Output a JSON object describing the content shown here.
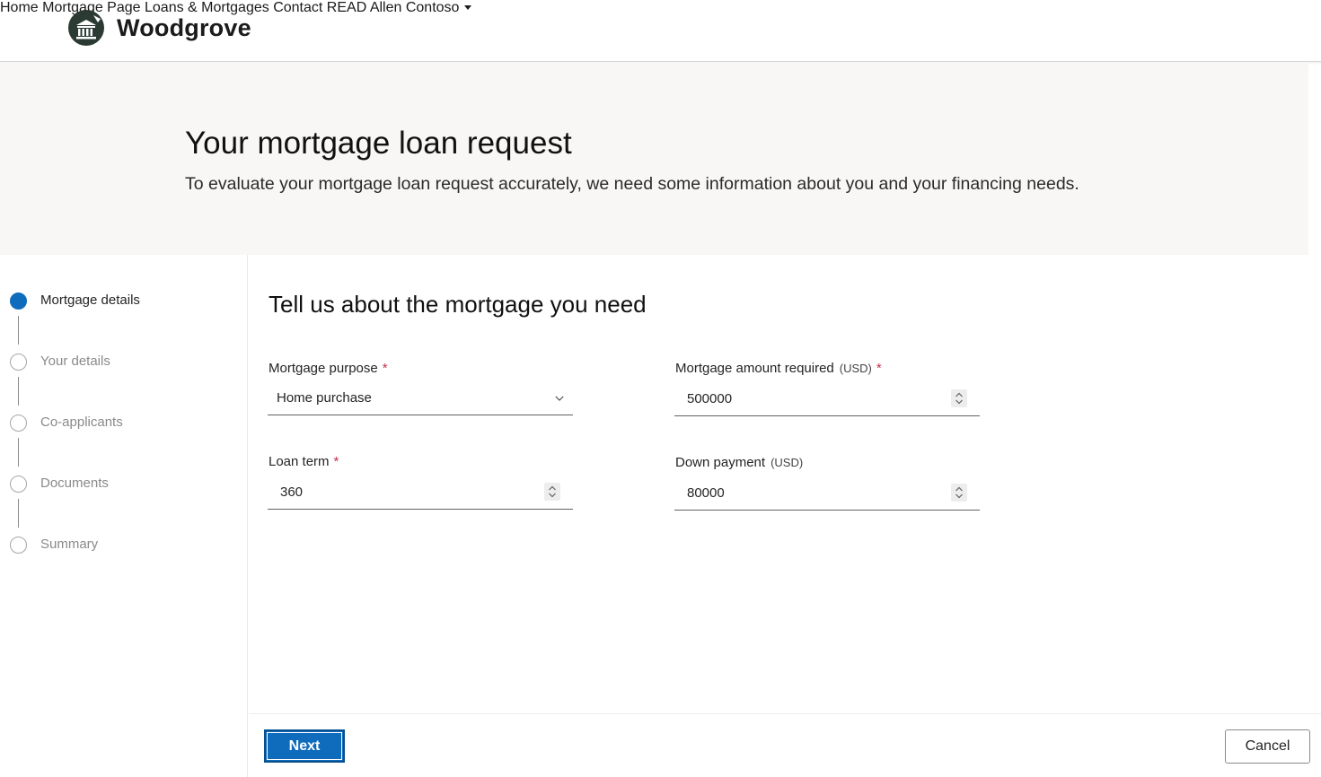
{
  "header": {
    "brand": "Woodgrove",
    "nav": [
      {
        "label": "Home"
      },
      {
        "label": "Mortgage Page"
      },
      {
        "label": "Loans & Mortgages"
      },
      {
        "label": "Contact READ"
      }
    ],
    "user": "Allen Contoso"
  },
  "hero": {
    "title": "Your mortgage loan request",
    "subtitle": "To evaluate your mortgage loan request accurately, we need some information about you and your financing needs."
  },
  "steps": [
    {
      "label": "Mortgage details",
      "active": true
    },
    {
      "label": "Your details",
      "active": false
    },
    {
      "label": "Co-applicants",
      "active": false
    },
    {
      "label": "Documents",
      "active": false
    },
    {
      "label": "Summary",
      "active": false
    }
  ],
  "form": {
    "title": "Tell us about the mortgage you need",
    "purpose": {
      "label": "Mortgage purpose",
      "required": "*",
      "value": "Home purchase"
    },
    "amount": {
      "label": "Mortgage amount required",
      "unit": "(USD)",
      "required": "*",
      "value": "500000"
    },
    "term": {
      "label": "Loan term",
      "required": "*",
      "value": "360"
    },
    "down": {
      "label": "Down payment",
      "unit": "(USD)",
      "value": "80000"
    }
  },
  "actions": {
    "next": "Next",
    "cancel": "Cancel"
  },
  "colors": {
    "accent": "#0f6cbd",
    "required": "#c4314b",
    "hero_bg": "#f8f7f5"
  }
}
